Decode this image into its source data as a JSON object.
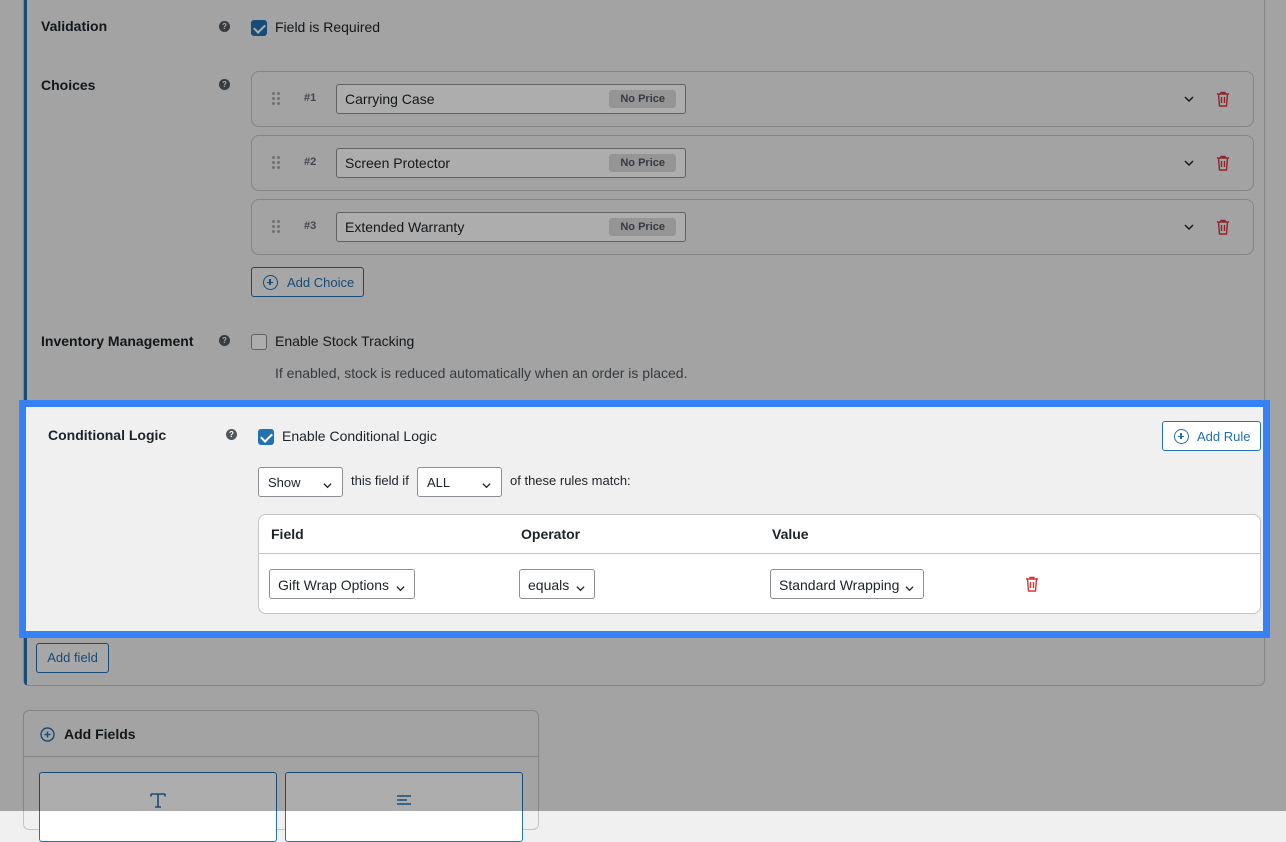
{
  "validation": {
    "label": "Validation",
    "help": "?",
    "checkbox_label": "Field is Required",
    "checked": true
  },
  "choices": {
    "label": "Choices",
    "help": "?",
    "items": [
      {
        "number": "#1",
        "value": "Carrying Case",
        "price": "No Price"
      },
      {
        "number": "#2",
        "value": "Screen Protector",
        "price": "No Price"
      },
      {
        "number": "#3",
        "value": "Extended Warranty",
        "price": "No Price"
      }
    ],
    "add_button": "Add Choice"
  },
  "inventory": {
    "label": "Inventory Management",
    "help": "?",
    "checkbox_label": "Enable Stock Tracking",
    "checked": false,
    "description": "If enabled, stock is reduced automatically when an order is placed."
  },
  "conditional_logic": {
    "label": "Conditional Logic",
    "help": "?",
    "checkbox_label": "Enable Conditional Logic",
    "checked": true,
    "add_rule_button": "Add Rule",
    "action_select": "Show",
    "text_middle": "this field if",
    "match_select": "ALL",
    "text_end": "of these rules match:",
    "rules_table": {
      "headers": [
        "Field",
        "Operator",
        "Value"
      ],
      "rows": [
        {
          "field": "Gift Wrap Options",
          "operator": "equals",
          "value": "Standard Wrapping"
        }
      ]
    }
  },
  "add_field_button": "Add field",
  "add_fields_panel": {
    "title": "Add Fields"
  },
  "colors": {
    "accent": "#2271b1",
    "highlight": "#3582f7",
    "danger": "#d63638"
  }
}
